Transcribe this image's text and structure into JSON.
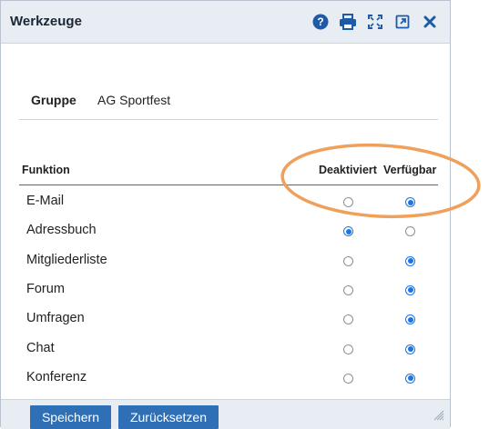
{
  "window": {
    "title": "Werkzeuge",
    "icons": [
      "help-icon",
      "print-icon",
      "fullscreen-icon",
      "open-external-icon",
      "close-icon"
    ]
  },
  "group": {
    "label": "Gruppe",
    "value": "AG Sportfest"
  },
  "table": {
    "headers": {
      "function": "Funktion",
      "disabled": "Deaktiviert",
      "available": "Verfügbar"
    },
    "rows": [
      {
        "label": "E-Mail",
        "selected": "available"
      },
      {
        "label": "Adressbuch",
        "selected": "disabled"
      },
      {
        "label": "Mitgliederliste",
        "selected": "available"
      },
      {
        "label": "Forum",
        "selected": "available"
      },
      {
        "label": "Umfragen",
        "selected": "available"
      },
      {
        "label": "Chat",
        "selected": "available"
      },
      {
        "label": "Konferenz",
        "selected": "available"
      }
    ]
  },
  "footer": {
    "save_label": "Speichern",
    "reset_label": "Zurücksetzen"
  },
  "colors": {
    "accent": "#2e6fb5",
    "radio_on": "#1a73e8",
    "highlight": "#f0a05a",
    "titlebar_bg": "#e7edf3"
  }
}
